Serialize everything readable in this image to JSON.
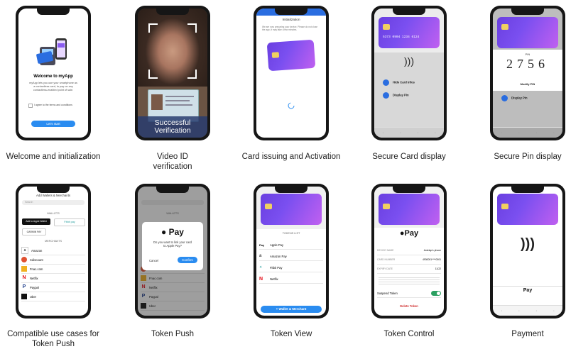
{
  "captions": [
    "Welcome and initialization",
    "Video ID verification",
    "Card issuing and Activation",
    "Secure Card display",
    "Secure Pin display",
    "Compatible use cases for Token Push",
    "Token Push",
    "Token View",
    "Token Control",
    "Payment"
  ],
  "welcome": {
    "title": "Welcome to myApp",
    "body": "myApp lets you use your smartphone as a contactless card, to pay on any contactless-enabled point of sale.",
    "terms": "I agree to the terms and conditions",
    "start_button": "Let's start"
  },
  "video": {
    "overlay": "Successful Verification"
  },
  "init": {
    "title": "Initialization",
    "body": "We are now preparing your device. Please do not close the app, it may take a few minutes."
  },
  "secure_card": {
    "card_number": "5373 0904 1234 6124",
    "hide": "Hide Card Infos",
    "display_pin": "Display Pin"
  },
  "secure_pin": {
    "pin_label": "PIN",
    "pin": "2756",
    "modify": "Modify PIN",
    "display_pin": "Display Pin"
  },
  "compatible": {
    "header": "Add Wallets & Merchants",
    "search": "Search",
    "wallets_label": "WALLETS",
    "wallets": [
      "Add to Apple Wallet",
      "Fitbit pay",
      "GARMIN PAY"
    ],
    "merchants_label": "MERCHANTS",
    "merchants": [
      "Amazon",
      "Cdiscount",
      "Fnac.com",
      "Netflix",
      "Paypal",
      "Uber"
    ]
  },
  "token_push": {
    "apple_pay": "Pay",
    "question": "Do you want to link your card to Apple Pay?",
    "cancel": "Cancel",
    "confirm": "Confirm",
    "wallets_label": "WALLETS",
    "merchants": [
      "Cdiscount",
      "Fnac.com",
      "Netflix",
      "Paypal",
      "Uber"
    ]
  },
  "token_view": {
    "list_label": "TOKENS LIST",
    "tokens": [
      "Apple Pay",
      "Amazon Pay",
      "Fitbit Pay",
      "Netflix"
    ],
    "button": "+ Wallet & Merchant"
  },
  "token_control": {
    "apple_pay": "Pay",
    "device_name_label": "DEVICE NAME",
    "device_name": "Antelop's phone",
    "card_number_label": "CARD NUMBER",
    "card_number": "4930001****0001",
    "expiry_label": "EXPIRY DATE",
    "expiry": "11/22",
    "suspend": "Suspend Token",
    "delete": "Delete Token"
  },
  "payment": {
    "label": "Pay"
  }
}
